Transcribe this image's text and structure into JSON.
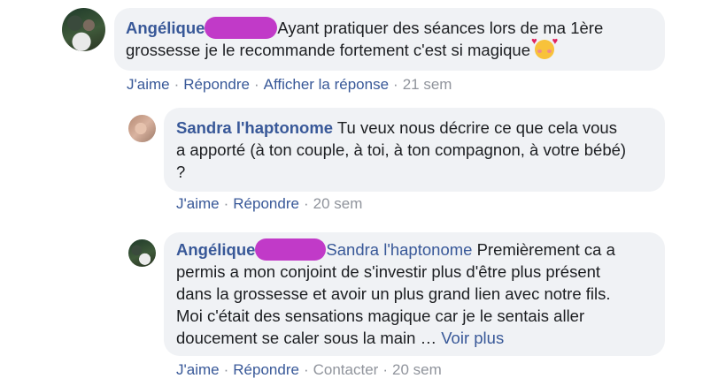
{
  "comments": [
    {
      "author": "Angélique",
      "text_line1": "Ayant pratiquer des séances lors de ma 1ère",
      "text_line2": "grossesse je le recommande fortement c'est si magique",
      "emoji": "smiling-face-with-hearts",
      "actions": {
        "like": "J'aime",
        "reply": "Répondre",
        "show_reply": "Afficher la réponse",
        "time": "21 sem"
      }
    },
    {
      "author": "Sandra l'haptonome",
      "text_line1": "Tu veux nous décrire ce que cela vous",
      "text_line2": "a apporté (à ton couple, à toi, à ton compagnon, à votre bébé)",
      "text_line3": "?",
      "actions": {
        "like": "J'aime",
        "reply": "Répondre",
        "time": "20 sem"
      }
    },
    {
      "author": "Angélique",
      "mention": "Sandra l'haptonome",
      "text_line1": "Premièrement ca a",
      "text_line2": "permis a mon conjoint de s'investir plus d'être plus présent",
      "text_line3": "dans la grossesse et avoir un plus grand lien avec notre fils.",
      "text_line4": "Moi c'était des sensations magique car je le sentais aller",
      "text_line5": "doucement se caler sous la main …",
      "see_more": "Voir plus",
      "actions": {
        "like": "J'aime",
        "reply": "Répondre",
        "contact": "Contacter",
        "time": "20 sem"
      }
    }
  ],
  "separator": "·",
  "colors": {
    "link": "#385898",
    "bubble": "#f0f2f5",
    "meta": "#90949c",
    "redaction": "#c13ac8"
  }
}
